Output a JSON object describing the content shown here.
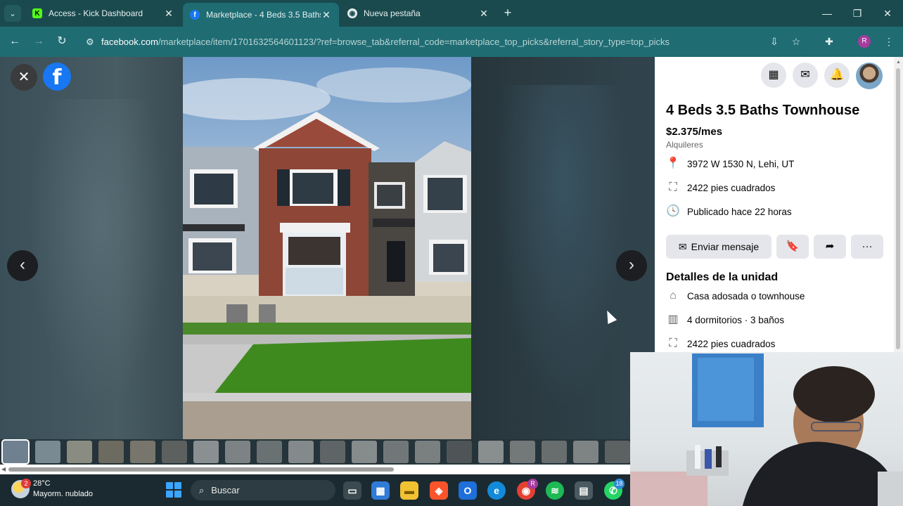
{
  "browser": {
    "tabs": [
      {
        "title": "Access - Kick Dashboard",
        "favicon": "kick-logo-icon",
        "active": false
      },
      {
        "title": "Marketplace - 4 Beds 3.5 Baths",
        "favicon": "facebook-icon",
        "active": true
      },
      {
        "title": "Nueva pestaña",
        "favicon": "chrome-icon",
        "active": false
      }
    ],
    "url_host": "facebook.com",
    "url_rest": "/marketplace/item/1701632564601123/?ref=browse_tab&referral_code=marketplace_top_picks&referral_story_type=top_picks",
    "profile_initial": "R",
    "accent": "#1f6c73"
  },
  "listing": {
    "title": "4 Beds 3.5 Baths Townhouse",
    "price": "$2.375/mes",
    "category": "Alquileres",
    "info": [
      {
        "icon": "location-pin-icon",
        "text": "3972 W 1530 N, Lehi, UT"
      },
      {
        "icon": "area-icon",
        "text": "2422 pies cuadrados"
      },
      {
        "icon": "clock-icon",
        "text": "Publicado hace 22 horas"
      }
    ],
    "message_button": "Enviar mensaje",
    "details_heading": "Detalles de la unidad",
    "details": [
      {
        "icon": "house-icon",
        "text": "Casa adosada o townhouse"
      },
      {
        "icon": "building-icon",
        "text": "4 dormitorios · 3 baños"
      },
      {
        "icon": "area-icon",
        "text": "2422 pies cuadrados"
      }
    ]
  },
  "taskbar": {
    "weather_badge": "2",
    "temperature": "28°C",
    "weather_desc": "Mayorm. nublado",
    "search_placeholder": "Buscar",
    "whatsapp_badge": "18",
    "chrome_badge": "R"
  }
}
